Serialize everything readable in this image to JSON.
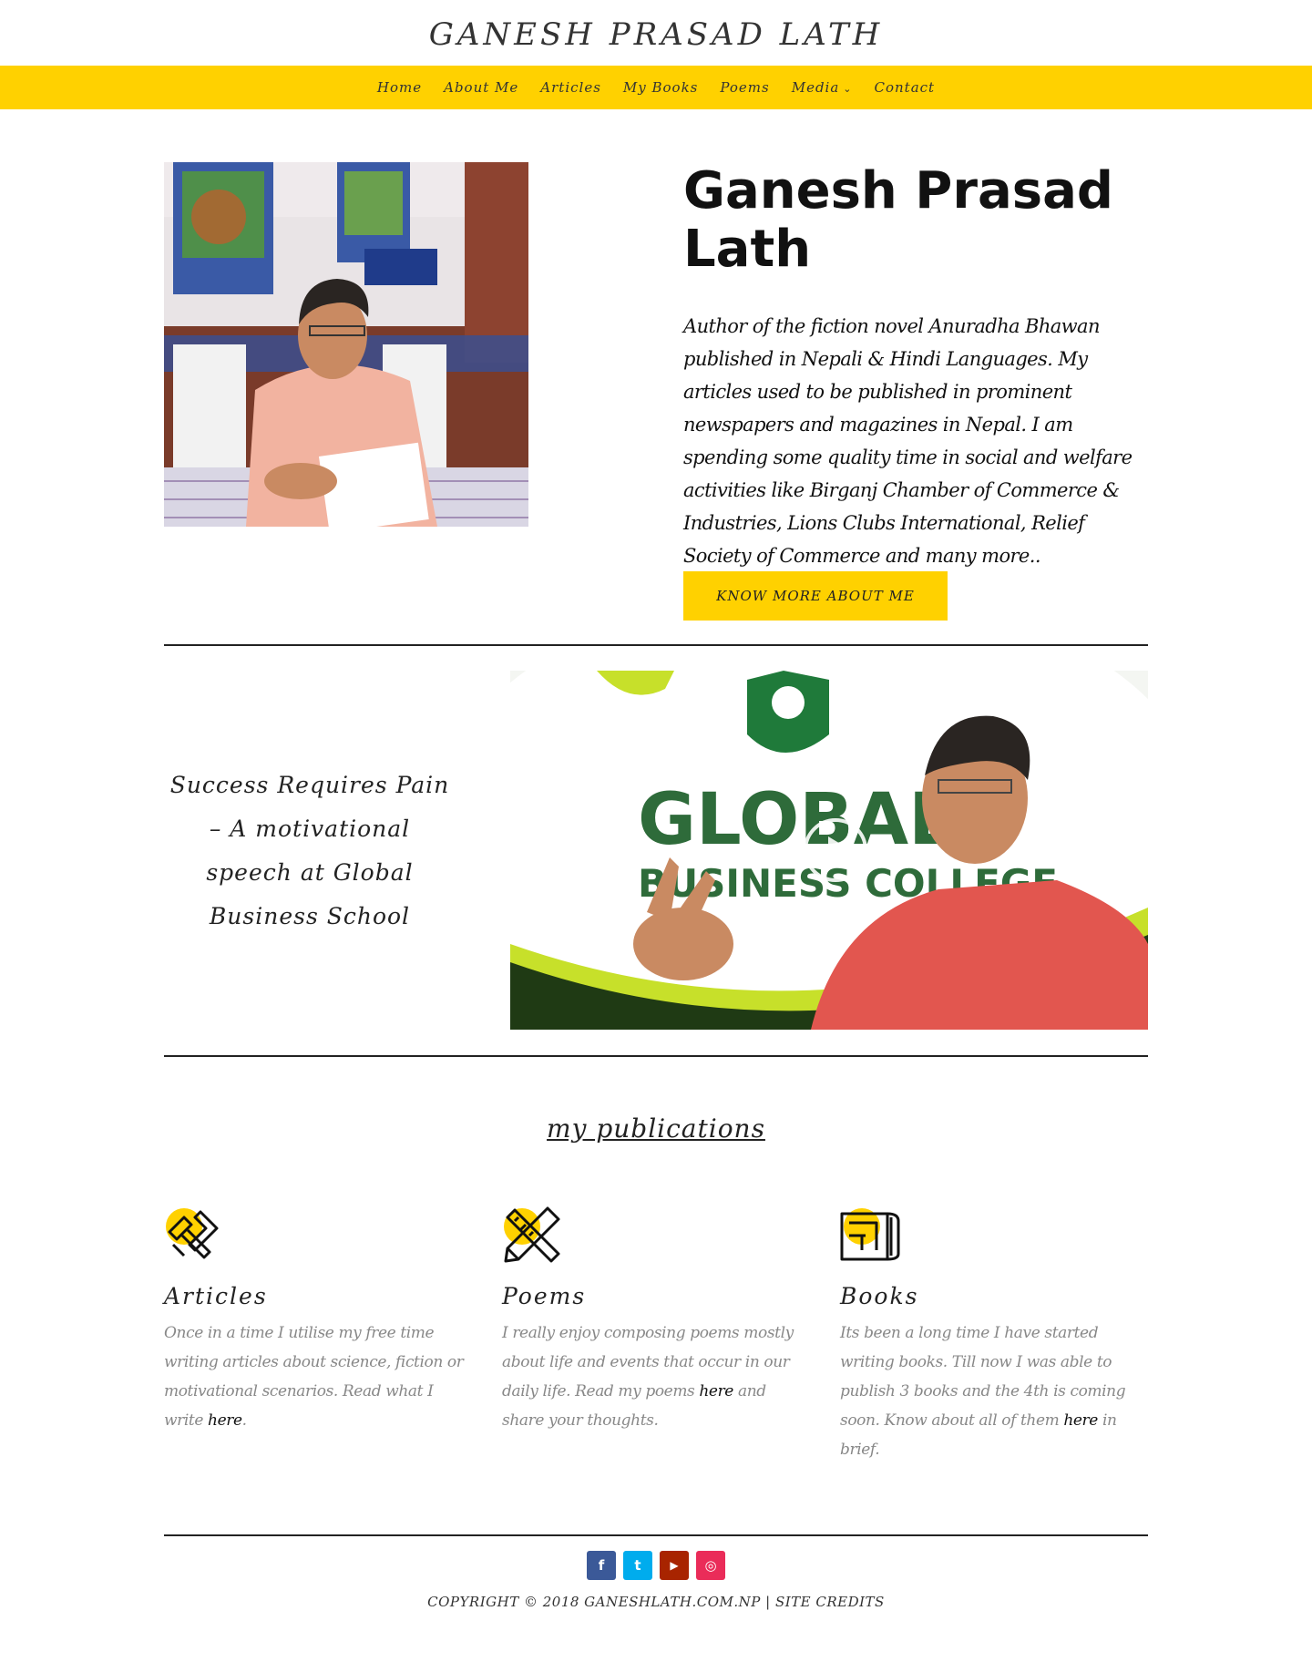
{
  "header": {
    "logo": "GANESH PRASAD LATH",
    "nav": [
      "Home",
      "About Me",
      "Articles",
      "My Books",
      "Poems",
      "Media",
      "Contact"
    ],
    "accent_color": "#ffd100"
  },
  "hero": {
    "title": "Ganesh Prasad Lath",
    "bio": "Author of the fiction novel Anuradha Bhawan published in Nepali & Hindi Languages. My articles used to be published in prominent newspapers and magazines in Nepal. I am spending some quality time in social and welfare activities like Birganj Chamber of Commerce & Industries, Lions Clubs International, Relief Society of Commerce and many more..",
    "button": "KNOW MORE ABOUT ME"
  },
  "video": {
    "caption": "Success Requires Pain – A motivational speech at Global Business School",
    "banner_line1": "GLOBAL",
    "banner_line2": "BUSINESS COLLEGE"
  },
  "publications": {
    "heading": "my publications",
    "items": [
      {
        "title": "Articles",
        "text_before": "Once in a time I utilise my free time writing articles about science, fiction or motivational scenarios. Read what I write ",
        "link": "here",
        "text_after": "."
      },
      {
        "title": "Poems",
        "text_before": "I really enjoy composing poems mostly about life and events that occur in our daily life. Read my poems ",
        "link": "here",
        "text_after": " and share your thoughts."
      },
      {
        "title": "Books",
        "text_before": "Its been a long time I have started writing books. Till now I was able to publish 3 books and the 4th is coming soon. Know about all of them ",
        "link": "here",
        "text_after": " in brief."
      }
    ]
  },
  "footer": {
    "social": [
      {
        "name": "facebook",
        "glyph": "f",
        "color": "#3b5998"
      },
      {
        "name": "twitter",
        "glyph": "t",
        "color": "#00aced"
      },
      {
        "name": "youtube",
        "glyph": "▶",
        "color": "#a82400"
      },
      {
        "name": "instagram",
        "glyph": "◎",
        "color": "#ea2c59"
      }
    ],
    "copyright": "COPYRIGHT © 2018 GANESHLATH.COM.NP | SITE CREDITS"
  }
}
